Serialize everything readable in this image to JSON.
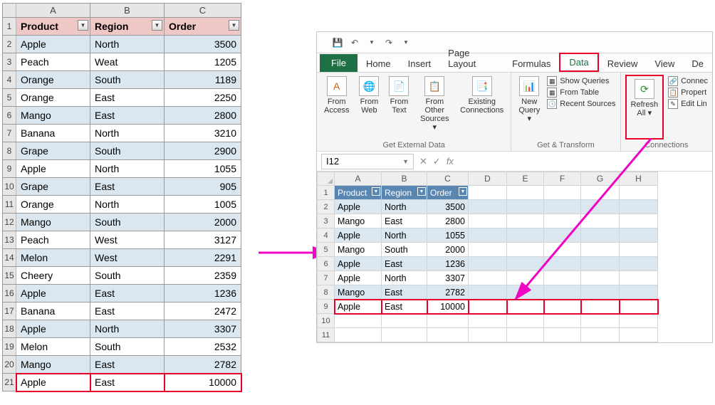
{
  "left": {
    "cols": [
      "A",
      "B",
      "C"
    ],
    "headers": {
      "product": "Product",
      "region": "Region",
      "order": "Order"
    },
    "rows": [
      {
        "n": "2",
        "p": "Apple",
        "r": "North",
        "o": "3500"
      },
      {
        "n": "3",
        "p": "Peach",
        "r": "Weat",
        "o": "1205"
      },
      {
        "n": "4",
        "p": "Orange",
        "r": "South",
        "o": "1189"
      },
      {
        "n": "5",
        "p": "Orange",
        "r": "East",
        "o": "2250"
      },
      {
        "n": "6",
        "p": "Mango",
        "r": "East",
        "o": "2800"
      },
      {
        "n": "7",
        "p": "Banana",
        "r": "North",
        "o": "3210"
      },
      {
        "n": "8",
        "p": "Grape",
        "r": "South",
        "o": "2900"
      },
      {
        "n": "9",
        "p": "Apple",
        "r": "North",
        "o": "1055"
      },
      {
        "n": "10",
        "p": "Grape",
        "r": "East",
        "o": "905"
      },
      {
        "n": "11",
        "p": "Orange",
        "r": "North",
        "o": "1005"
      },
      {
        "n": "12",
        "p": "Mango",
        "r": "South",
        "o": "2000"
      },
      {
        "n": "13",
        "p": "Peach",
        "r": "West",
        "o": "3127"
      },
      {
        "n": "14",
        "p": "Melon",
        "r": "West",
        "o": "2291"
      },
      {
        "n": "15",
        "p": "Cheery",
        "r": "South",
        "o": "2359"
      },
      {
        "n": "16",
        "p": "Apple",
        "r": "East",
        "o": "1236"
      },
      {
        "n": "17",
        "p": "Banana",
        "r": "East",
        "o": "2472"
      },
      {
        "n": "18",
        "p": "Apple",
        "r": "North",
        "o": "3307"
      },
      {
        "n": "19",
        "p": "Melon",
        "r": "South",
        "o": "2532"
      },
      {
        "n": "20",
        "p": "Mango",
        "r": "East",
        "o": "2782"
      },
      {
        "n": "21",
        "p": "Apple",
        "r": "East",
        "o": "10000"
      }
    ]
  },
  "win": {
    "namebox": "I12",
    "tabs": {
      "file": "File",
      "home": "Home",
      "insert": "Insert",
      "layout": "Page Layout",
      "formulas": "Formulas",
      "data": "Data",
      "review": "Review",
      "view": "View",
      "dev": "De"
    },
    "ribbon": {
      "g1": {
        "label": "Get External Data",
        "access": "From Access",
        "web": "From Web",
        "text": "From Text",
        "other": "From Other Sources ▾",
        "exist": "Existing Connections"
      },
      "g2": {
        "label": "Get & Transform",
        "newq": "New Query ▾",
        "show": "Show Queries",
        "table": "From Table",
        "recent": "Recent Sources"
      },
      "g3": {
        "label": "Connections",
        "refresh": "Refresh All ▾",
        "connec": "Connec",
        "proper": "Propert",
        "edit": "Edit Lin"
      }
    },
    "fx": "fx"
  },
  "right": {
    "cols": [
      "A",
      "B",
      "C",
      "D",
      "E",
      "F",
      "G",
      "H"
    ],
    "headers": {
      "product": "Product",
      "region": "Region",
      "order": "Order"
    },
    "rows": [
      {
        "n": "2",
        "p": "Apple",
        "r": "North",
        "o": "3500"
      },
      {
        "n": "3",
        "p": "Mango",
        "r": "East",
        "o": "2800"
      },
      {
        "n": "4",
        "p": "Apple",
        "r": "North",
        "o": "1055"
      },
      {
        "n": "5",
        "p": "Mango",
        "r": "South",
        "o": "2000"
      },
      {
        "n": "6",
        "p": "Apple",
        "r": "East",
        "o": "1236"
      },
      {
        "n": "7",
        "p": "Apple",
        "r": "North",
        "o": "3307"
      },
      {
        "n": "8",
        "p": "Mango",
        "r": "East",
        "o": "2782"
      },
      {
        "n": "9",
        "p": "Apple",
        "r": "East",
        "o": "10000"
      }
    ],
    "empty": [
      "10",
      "11"
    ]
  }
}
